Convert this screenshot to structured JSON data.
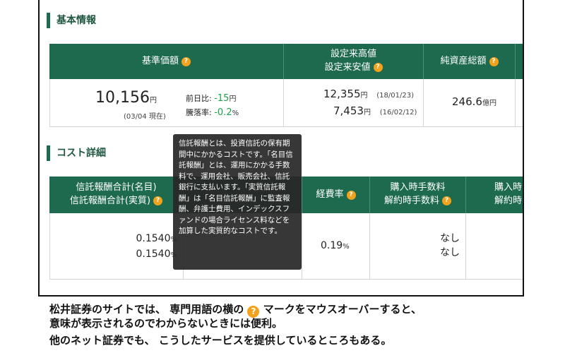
{
  "basic": {
    "title": "基本情報",
    "col_nav": "基準価額",
    "col_high_low": [
      "設定来高値",
      "設定来安値"
    ],
    "col_assets": "純資産総額",
    "nav_value": "10,156",
    "nav_unit": "円",
    "nav_date": "(03/04 現在)",
    "prev_label": "前日比:",
    "prev_value": "-15",
    "prev_unit": "円",
    "rate_label": "騰落率:",
    "rate_value": "-0.2",
    "rate_unit": "%",
    "high_value": "12,355",
    "high_unit": "円",
    "high_date": "(18/01/23)",
    "low_value": "7,453",
    "low_unit": "円",
    "low_date": "(16/02/12)",
    "assets_value": "246.6",
    "assets_unit": "億円"
  },
  "cost": {
    "title": "コスト詳細",
    "col_fee": [
      "信託報酬合計(名目)",
      "信託報酬合計(実質)"
    ],
    "col_expense": "経費率",
    "col_purchase": [
      "購入時手数料",
      "解約時手数料"
    ],
    "col_purchase2": [
      "購入時",
      "解約時"
    ],
    "fee_nominal": "0.1540",
    "fee_actual": "0.1540",
    "fee_unit": "%",
    "expense_value": "0.19",
    "expense_unit": "%",
    "purchase_fee": "なし",
    "redemption_fee": "なし"
  },
  "tooltip": {
    "text": "信託報酬とは、投資信託の保有期間中にかかるコストです。「名目信託報酬」とは、運用にかかる手数料で、運用会社、販売会社、信託銀行に支払います。「実質信託報酬」は「名目信託報酬」に監査報酬、弁護士費用、インデックスファンドの場合ライセンス料などを加算した実質的なコストです。"
  },
  "help_icon": "?",
  "caption": {
    "line1_a": "松井証券のサイトでは、 専門用語の横の",
    "line1_b": "マークをマウスオーバーすると、",
    "line2": "意味が表示されるのでわからないときには便利。",
    "line3": "他のネット証券でも、 こうしたサービスを提供しているところもある。"
  }
}
